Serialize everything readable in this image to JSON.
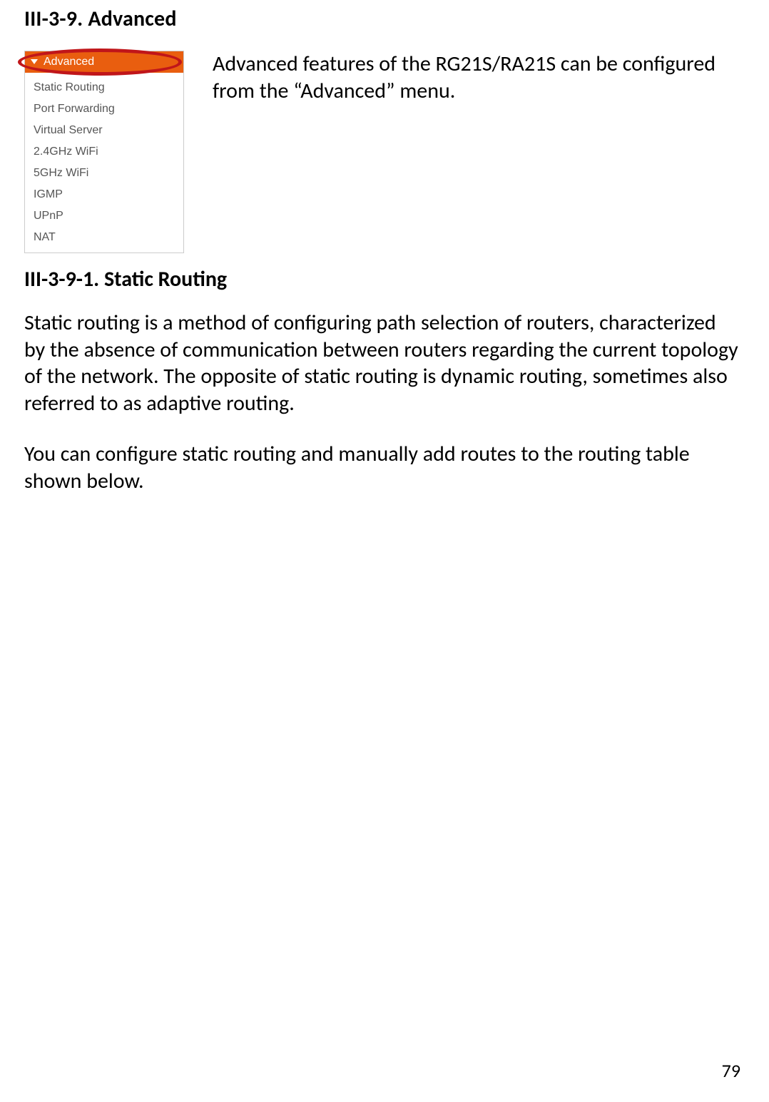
{
  "headings": {
    "section": "III-3-9.  Advanced",
    "subsection": "III-3-9-1.    Static Routing"
  },
  "intro": "Advanced features of the RG21S/RA21S can be configured from the “Advanced” menu.",
  "menu": {
    "header": "Advanced",
    "items": [
      "Static Routing",
      "Port Forwarding",
      "Virtual Server",
      "2.4GHz WiFi",
      "5GHz WiFi",
      "IGMP",
      "UPnP",
      "NAT"
    ]
  },
  "paragraphs": {
    "p1": "Static routing is a method of configuring path selection of routers, characterized by the absence of communication between routers regarding the current topology of the network. The opposite of static routing is dynamic routing, sometimes also referred to as adaptive routing.",
    "p2": "You can configure static routing and manually add routes to the routing table shown below."
  },
  "page_number": "79"
}
